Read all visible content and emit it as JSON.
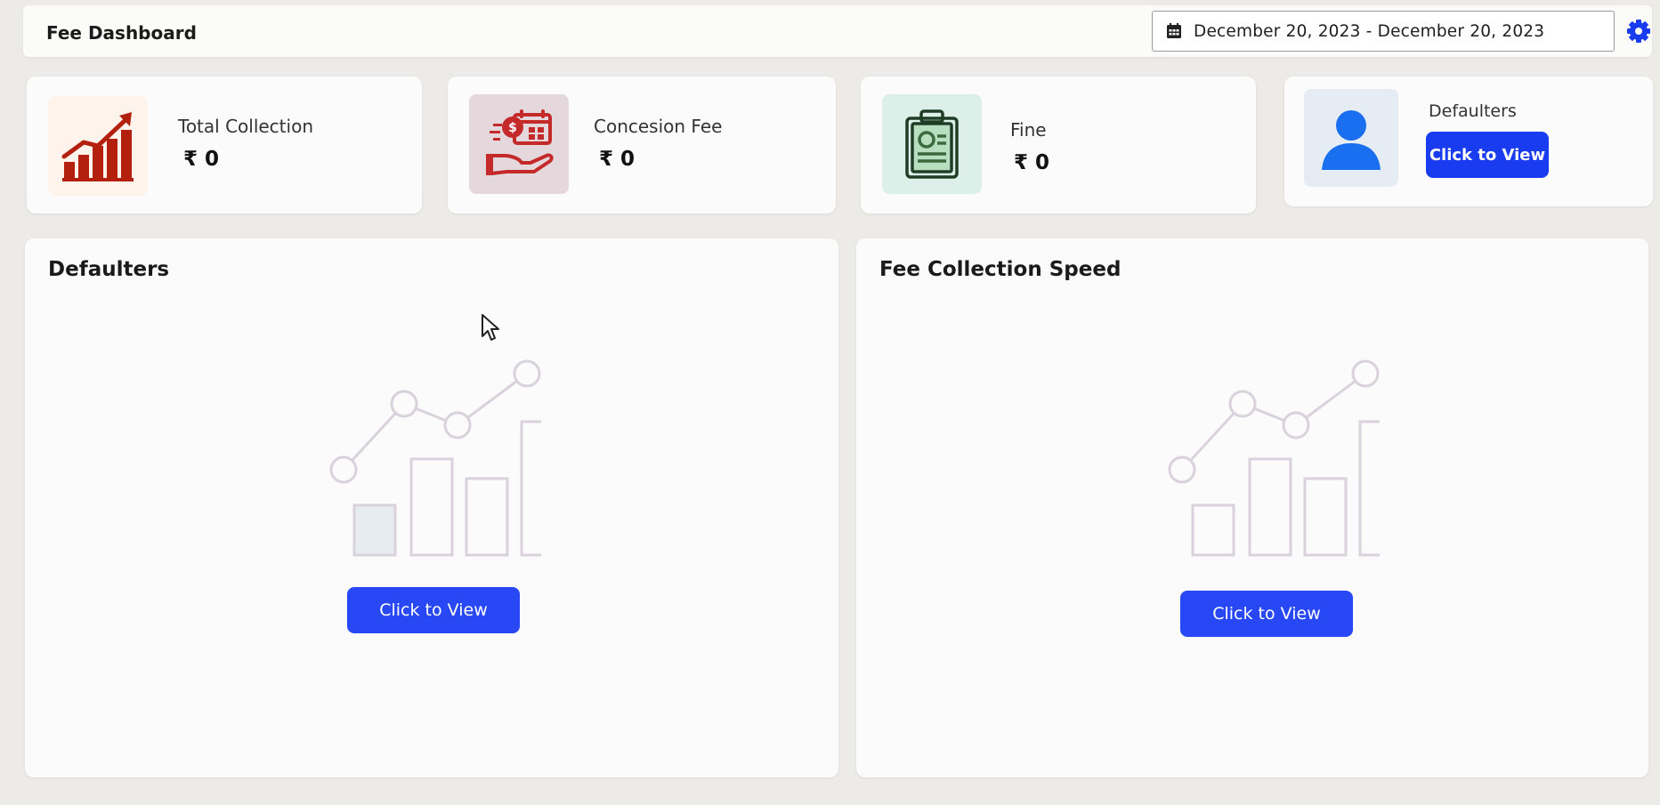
{
  "header": {
    "title": "Fee Dashboard",
    "date_range": "December 20, 2023 - December 20, 2023",
    "calendar_icon": "calendar-icon",
    "settings_icon": "gear-icon"
  },
  "stats": [
    {
      "label": "Total Collection",
      "amount": "₹ 0",
      "icon": "growth-chart-icon",
      "icon_bg": "#fff4ec"
    },
    {
      "label": "Concesion Fee",
      "amount": "₹ 0",
      "icon": "fee-hand-icon",
      "icon_bg": "#e4d8dc"
    },
    {
      "label": "Fine",
      "amount": "₹ 0",
      "icon": "clipboard-icon",
      "icon_bg": "#dcefe9"
    },
    {
      "label": "Defaulters",
      "button": "Click to View",
      "icon": "user-icon",
      "icon_bg": "#e6ecf4"
    }
  ],
  "panels": [
    {
      "title": "Defaulters",
      "button": "Click to View",
      "placeholder_icon": "empty-chart-icon"
    },
    {
      "title": "Fee Collection Speed",
      "button": "Click to View",
      "placeholder_icon": "empty-chart-icon"
    }
  ],
  "colors": {
    "primary_button": "#1a3cf0",
    "growth_icon": "#b3200e",
    "fee_icon": "#c42a2a",
    "clipboard_icon": "#1f5a2a",
    "user_icon": "#1a6ef0",
    "settings_icon": "#1a3cf0"
  }
}
